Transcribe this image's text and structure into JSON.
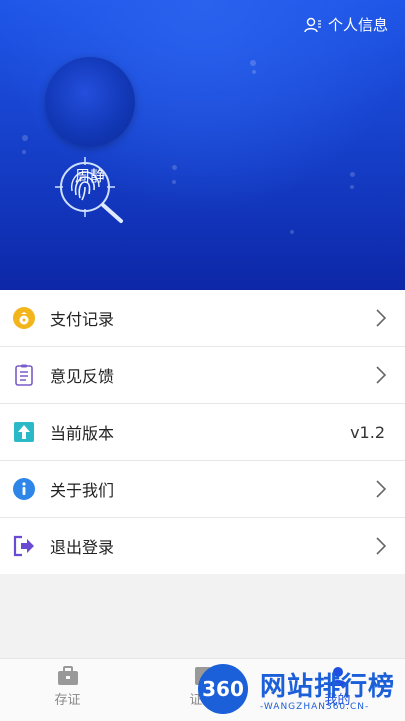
{
  "header": {
    "profile_link_label": "个人信息",
    "user_name": "周静"
  },
  "menu": [
    {
      "label": "支付记录",
      "icon": "money-bag-icon",
      "color": "#f2b51c"
    },
    {
      "label": "意见反馈",
      "icon": "clipboard-icon",
      "color": "#7a5cc7"
    },
    {
      "label": "当前版本",
      "icon": "upload-icon",
      "color": "#2bb8c7",
      "value": "v1.2"
    },
    {
      "label": "关于我们",
      "icon": "info-icon",
      "color": "#2d86e8"
    },
    {
      "label": "退出登录",
      "icon": "logout-icon",
      "color": "#6a4ad0"
    }
  ],
  "tabbar": {
    "tabs": [
      {
        "label": "存证"
      },
      {
        "label": "证据"
      },
      {
        "label": "我的"
      }
    ]
  },
  "watermark": {
    "badge": "360",
    "title": "网站排行榜",
    "subtitle": "-WANGZHAN360.CN-"
  },
  "colors": {
    "header_top": "#1f56e8",
    "header_bottom": "#0d27a8",
    "accent": "#1f4fe0"
  }
}
